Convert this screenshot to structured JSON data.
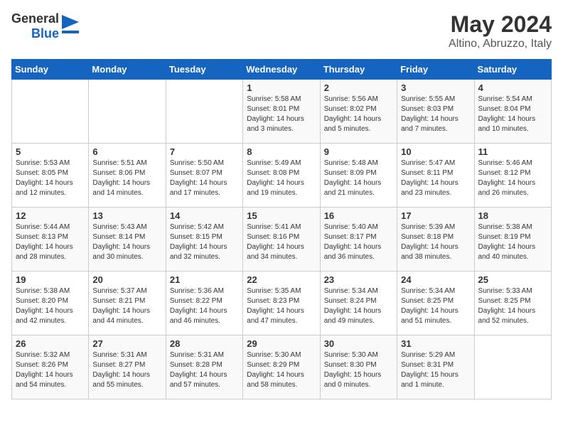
{
  "header": {
    "logo_general": "General",
    "logo_blue": "Blue",
    "month": "May 2024",
    "location": "Altino, Abruzzo, Italy"
  },
  "days_of_week": [
    "Sunday",
    "Monday",
    "Tuesday",
    "Wednesday",
    "Thursday",
    "Friday",
    "Saturday"
  ],
  "weeks": [
    [
      {
        "day": "",
        "info": ""
      },
      {
        "day": "",
        "info": ""
      },
      {
        "day": "",
        "info": ""
      },
      {
        "day": "1",
        "info": "Sunrise: 5:58 AM\nSunset: 8:01 PM\nDaylight: 14 hours\nand 3 minutes."
      },
      {
        "day": "2",
        "info": "Sunrise: 5:56 AM\nSunset: 8:02 PM\nDaylight: 14 hours\nand 5 minutes."
      },
      {
        "day": "3",
        "info": "Sunrise: 5:55 AM\nSunset: 8:03 PM\nDaylight: 14 hours\nand 7 minutes."
      },
      {
        "day": "4",
        "info": "Sunrise: 5:54 AM\nSunset: 8:04 PM\nDaylight: 14 hours\nand 10 minutes."
      }
    ],
    [
      {
        "day": "5",
        "info": "Sunrise: 5:53 AM\nSunset: 8:05 PM\nDaylight: 14 hours\nand 12 minutes."
      },
      {
        "day": "6",
        "info": "Sunrise: 5:51 AM\nSunset: 8:06 PM\nDaylight: 14 hours\nand 14 minutes."
      },
      {
        "day": "7",
        "info": "Sunrise: 5:50 AM\nSunset: 8:07 PM\nDaylight: 14 hours\nand 17 minutes."
      },
      {
        "day": "8",
        "info": "Sunrise: 5:49 AM\nSunset: 8:08 PM\nDaylight: 14 hours\nand 19 minutes."
      },
      {
        "day": "9",
        "info": "Sunrise: 5:48 AM\nSunset: 8:09 PM\nDaylight: 14 hours\nand 21 minutes."
      },
      {
        "day": "10",
        "info": "Sunrise: 5:47 AM\nSunset: 8:11 PM\nDaylight: 14 hours\nand 23 minutes."
      },
      {
        "day": "11",
        "info": "Sunrise: 5:46 AM\nSunset: 8:12 PM\nDaylight: 14 hours\nand 26 minutes."
      }
    ],
    [
      {
        "day": "12",
        "info": "Sunrise: 5:44 AM\nSunset: 8:13 PM\nDaylight: 14 hours\nand 28 minutes."
      },
      {
        "day": "13",
        "info": "Sunrise: 5:43 AM\nSunset: 8:14 PM\nDaylight: 14 hours\nand 30 minutes."
      },
      {
        "day": "14",
        "info": "Sunrise: 5:42 AM\nSunset: 8:15 PM\nDaylight: 14 hours\nand 32 minutes."
      },
      {
        "day": "15",
        "info": "Sunrise: 5:41 AM\nSunset: 8:16 PM\nDaylight: 14 hours\nand 34 minutes."
      },
      {
        "day": "16",
        "info": "Sunrise: 5:40 AM\nSunset: 8:17 PM\nDaylight: 14 hours\nand 36 minutes."
      },
      {
        "day": "17",
        "info": "Sunrise: 5:39 AM\nSunset: 8:18 PM\nDaylight: 14 hours\nand 38 minutes."
      },
      {
        "day": "18",
        "info": "Sunrise: 5:38 AM\nSunset: 8:19 PM\nDaylight: 14 hours\nand 40 minutes."
      }
    ],
    [
      {
        "day": "19",
        "info": "Sunrise: 5:38 AM\nSunset: 8:20 PM\nDaylight: 14 hours\nand 42 minutes."
      },
      {
        "day": "20",
        "info": "Sunrise: 5:37 AM\nSunset: 8:21 PM\nDaylight: 14 hours\nand 44 minutes."
      },
      {
        "day": "21",
        "info": "Sunrise: 5:36 AM\nSunset: 8:22 PM\nDaylight: 14 hours\nand 46 minutes."
      },
      {
        "day": "22",
        "info": "Sunrise: 5:35 AM\nSunset: 8:23 PM\nDaylight: 14 hours\nand 47 minutes."
      },
      {
        "day": "23",
        "info": "Sunrise: 5:34 AM\nSunset: 8:24 PM\nDaylight: 14 hours\nand 49 minutes."
      },
      {
        "day": "24",
        "info": "Sunrise: 5:34 AM\nSunset: 8:25 PM\nDaylight: 14 hours\nand 51 minutes."
      },
      {
        "day": "25",
        "info": "Sunrise: 5:33 AM\nSunset: 8:25 PM\nDaylight: 14 hours\nand 52 minutes."
      }
    ],
    [
      {
        "day": "26",
        "info": "Sunrise: 5:32 AM\nSunset: 8:26 PM\nDaylight: 14 hours\nand 54 minutes."
      },
      {
        "day": "27",
        "info": "Sunrise: 5:31 AM\nSunset: 8:27 PM\nDaylight: 14 hours\nand 55 minutes."
      },
      {
        "day": "28",
        "info": "Sunrise: 5:31 AM\nSunset: 8:28 PM\nDaylight: 14 hours\nand 57 minutes."
      },
      {
        "day": "29",
        "info": "Sunrise: 5:30 AM\nSunset: 8:29 PM\nDaylight: 14 hours\nand 58 minutes."
      },
      {
        "day": "30",
        "info": "Sunrise: 5:30 AM\nSunset: 8:30 PM\nDaylight: 15 hours\nand 0 minutes."
      },
      {
        "day": "31",
        "info": "Sunrise: 5:29 AM\nSunset: 8:31 PM\nDaylight: 15 hours\nand 1 minute."
      },
      {
        "day": "",
        "info": ""
      }
    ]
  ]
}
